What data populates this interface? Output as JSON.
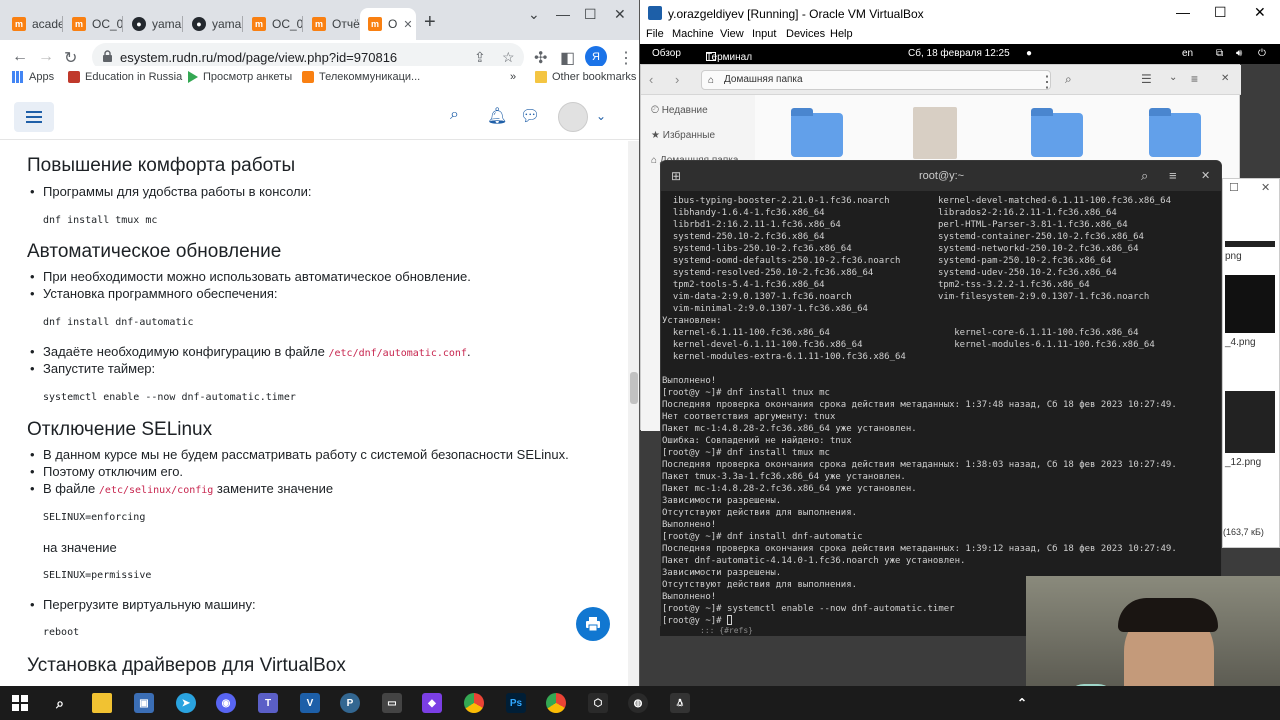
{
  "browser": {
    "tabs": [
      {
        "label": "acade"
      },
      {
        "label": "ОС_0"
      },
      {
        "label": "yama"
      },
      {
        "label": "yama"
      },
      {
        "label": "ОС_0"
      },
      {
        "label": "Отчё"
      },
      {
        "label": "О"
      }
    ],
    "url": "esystem.rudn.ru/mod/page/view.php?id=970816",
    "bookmarks": [
      {
        "label": "Apps"
      },
      {
        "label": "Education in Russia"
      },
      {
        "label": "Просмотр анкеты"
      },
      {
        "label": "Телекоммуникаци..."
      },
      {
        "label": "»"
      },
      {
        "label": "Other bookmarks"
      }
    ],
    "profile_letter": "Я"
  },
  "page": {
    "s1_title": "Повышение комфорта работы",
    "s1_item1": "Программы для удобства работы в консоли:",
    "s1_code": "dnf install tmux mc",
    "s2_title": "Автоматическое обновление",
    "s2_item1": "При необходимости можно использовать автоматическое обновление.",
    "s2_item2": "Установка программного обеспечения:",
    "s2_code1": "dnf install dnf-automatic",
    "s2_item3_pre": "Задаёте необходимую конфигурацию в файле ",
    "s2_item3_path": "/etc/dnf/automatic.conf",
    "s2_item3_post": ".",
    "s2_item4": "Запустите таймер:",
    "s2_code2": "systemctl enable --now dnf-automatic.timer",
    "s3_title": "Отключение SELinux",
    "s3_item1": "В данном курсе мы не будем рассматривать работу с системой безопасности SELinux.",
    "s3_item2": "Поэтому отключим его.",
    "s3_item3_pre": "В файле ",
    "s3_item3_path": "/etc/selinux/config",
    "s3_item3_post": " замените значение",
    "s3_code1": "SELINUX=enforcing",
    "s3_text": "на значение",
    "s3_code2": "SELINUX=permissive",
    "s3_item4": "Перегрузите виртуальную машину:",
    "s3_code3": "reboot",
    "s4_title": "Установка драйверов для VirtualBox"
  },
  "vbox": {
    "title": "y.orazgeldiyev [Running] - Oracle VM VirtualBox",
    "menu": [
      "File",
      "Machine",
      "View",
      "Input",
      "Devices",
      "Help"
    ],
    "gnome": {
      "overview": "Обзор",
      "app": "Терминал",
      "clock": "Сб, 18 февраля  12:25",
      "lang": "en"
    },
    "files": {
      "path": "Домашняя папка",
      "sidebar": [
        "Недавние",
        "Избранные",
        "Домашняя папка"
      ]
    },
    "sidewin": {
      "files": [
        "png",
        "_4.png",
        "_12.png"
      ],
      "size": "(163,7 кБ)"
    },
    "terminal": {
      "title": "root@y:~",
      "pairs": [
        [
          "  ibus-typing-booster-2.21.0-1.fc36.noarch",
          "kernel-devel-matched-6.1.11-100.fc36.x86_64"
        ],
        [
          "  libhandy-1.6.4-1.fc36.x86_64",
          "librados2-2:16.2.11-1.fc36.x86_64"
        ],
        [
          "  librbd1-2:16.2.11-1.fc36.x86_64",
          "perl-HTML-Parser-3.81-1.fc36.x86_64"
        ],
        [
          "  systemd-250.10-2.fc36.x86_64",
          "systemd-container-250.10-2.fc36.x86_64"
        ],
        [
          "  systemd-libs-250.10-2.fc36.x86_64",
          "systemd-networkd-250.10-2.fc36.x86_64"
        ],
        [
          "  systemd-oomd-defaults-250.10-2.fc36.noarch",
          "systemd-pam-250.10-2.fc36.x86_64"
        ],
        [
          "  systemd-resolved-250.10-2.fc36.x86_64",
          "systemd-udev-250.10-2.fc36.x86_64"
        ],
        [
          "  tpm2-tools-5.4-1.fc36.x86_64",
          "tpm2-tss-3.2.2-1.fc36.x86_64"
        ],
        [
          "  vim-data-2:9.0.1307-1.fc36.noarch",
          "vim-filesystem-2:9.0.1307-1.fc36.noarch"
        ],
        [
          "  vim-minimal-2:9.0.1307-1.fc36.x86_64",
          ""
        ],
        [
          "Установлен:",
          ""
        ],
        [
          "  kernel-6.1.11-100.fc36.x86_64",
          "   kernel-core-6.1.11-100.fc36.x86_64"
        ],
        [
          "  kernel-devel-6.1.11-100.fc36.x86_64",
          "   kernel-modules-6.1.11-100.fc36.x86_64"
        ],
        [
          "  kernel-modules-extra-6.1.11-100.fc36.x86_64",
          ""
        ],
        [
          "",
          ""
        ]
      ],
      "lines": [
        "Выполнено!",
        "[root@y ~]# dnf install tnux mc",
        "Последняя проверка окончания срока действия метаданных: 1:37:48 назад, Сб 18 фев 2023 10:27:49.",
        "Нет соответствия аргументу: tnux",
        "Пакет mc-1:4.8.28-2.fc36.x86_64 уже установлен.",
        "Ошибка: Совпадений не найдено: tnux",
        "[root@y ~]# dnf install tmux mc",
        "Последняя проверка окончания срока действия метаданных: 1:38:03 назад, Сб 18 фев 2023 10:27:49.",
        "Пакет tmux-3.3a-1.fc36.x86_64 уже установлен.",
        "Пакет mc-1:4.8.28-2.fc36.x86_64 уже установлен.",
        "Зависимости разрешены.",
        "Отсутствуют действия для выполнения.",
        "Выполнено!",
        "[root@y ~]# dnf install dnf-automatic",
        "Последняя проверка окончания срока действия метаданных: 1:39:12 назад, Сб 18 фев 2023 10:27:49.",
        "Пакет dnf-automatic-4.14.0-1.fc36.noarch уже установлен.",
        "Зависимости разрешены.",
        "Отсутствуют действия для выполнения.",
        "Выполнено!",
        "[root@y ~]# systemctl enable --now dnf-automatic.timer",
        "[root@y ~]# "
      ],
      "status": "::: {#refs}"
    }
  },
  "colors": {
    "accent": "#1177d1",
    "moodle": "#f98012",
    "folder": "#62a0ea"
  }
}
